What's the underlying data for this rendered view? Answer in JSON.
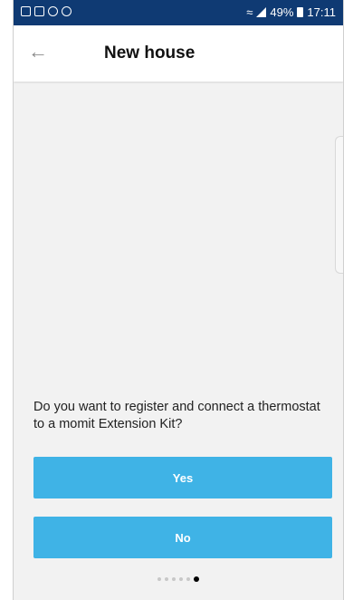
{
  "status_bar": {
    "battery": "49%",
    "time": "17:11"
  },
  "app_bar": {
    "title": "New house",
    "back_icon": "back-arrow-icon"
  },
  "content": {
    "question": "Do you want to register and connect a thermostat to a momit Extension Kit?"
  },
  "buttons": {
    "yes_label": "Yes",
    "no_label": "No"
  },
  "pager": {
    "total": 6,
    "active_index": 5
  },
  "colors": {
    "status_bar": "#0f3a73",
    "button": "#3fb3e6",
    "background": "#f2f2f2"
  }
}
